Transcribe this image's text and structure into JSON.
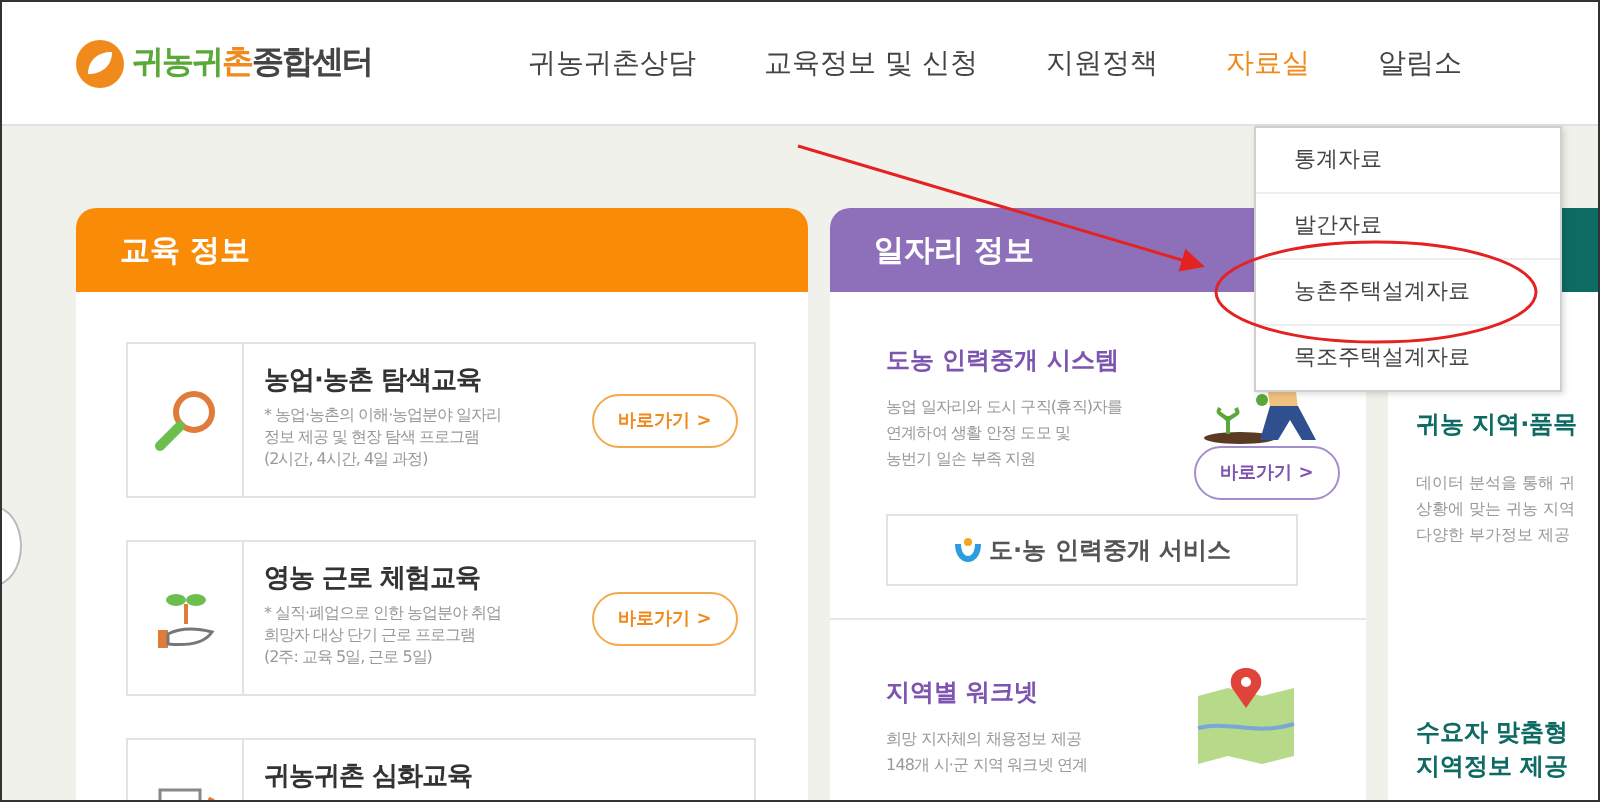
{
  "header": {
    "logo": {
      "part1": "귀농귀",
      "part2": "촌",
      "part3": "종합센터"
    },
    "nav": [
      {
        "label": "귀농귀촌상담",
        "selected": false
      },
      {
        "label": "교육정보 및 신청",
        "selected": false
      },
      {
        "label": "지원정책",
        "selected": false
      },
      {
        "label": "자료실",
        "selected": true
      },
      {
        "label": "알림소",
        "selected": false
      }
    ]
  },
  "dropdown": [
    {
      "label": "통계자료"
    },
    {
      "label": "발간자료"
    },
    {
      "label": "농촌주택설계자료"
    },
    {
      "label": "목조주택설계자료"
    }
  ],
  "education": {
    "title": "교육 정보",
    "items": [
      {
        "title": "농업·농촌 탐색교육",
        "lines": [
          "* 농업·농촌의 이해·농업분야 일자리",
          "정보 제공 및 현장 탐색 프로그램",
          "(2시간, 4시간, 4일 과정)"
        ],
        "button": "바로가기 >"
      },
      {
        "title": "영농 근로 체험교육",
        "lines": [
          "* 실직·폐업으로 인한 농업분야 취업",
          "희망자 대상 단기 근로 프로그램",
          "(2주: 교육 5일, 근로 5일)"
        ],
        "button": "바로가기 >"
      },
      {
        "title": "귀농귀촌 심화교육"
      }
    ]
  },
  "jobs": {
    "title": "일자리 정보",
    "sections": [
      {
        "title": "도농 인력중개 시스템",
        "lines": [
          "농업 일자리와 도시 구직(휴직)자를",
          "연계하여 생활 안정 도모 및",
          "농번기 일손 부족 지원"
        ],
        "button": "바로가기 >",
        "service": "도·농 인력중개 서비스"
      },
      {
        "title": "지역별 워크넷",
        "lines": [
          "희망 지자체의 채용정보 제공",
          "148개 시·군 지역 워크넷 연계"
        ]
      }
    ]
  },
  "data": {
    "blocks": [
      {
        "title_lines": [
          "귀농 지역·품목"
        ],
        "lines": [
          "데이터 분석을 통해 귀",
          "상황에 맞는 귀농 지역",
          "다양한 부가정보 제공"
        ]
      },
      {
        "title_lines": [
          "수요자 맞춤형",
          "지역정보 제공"
        ]
      }
    ]
  }
}
